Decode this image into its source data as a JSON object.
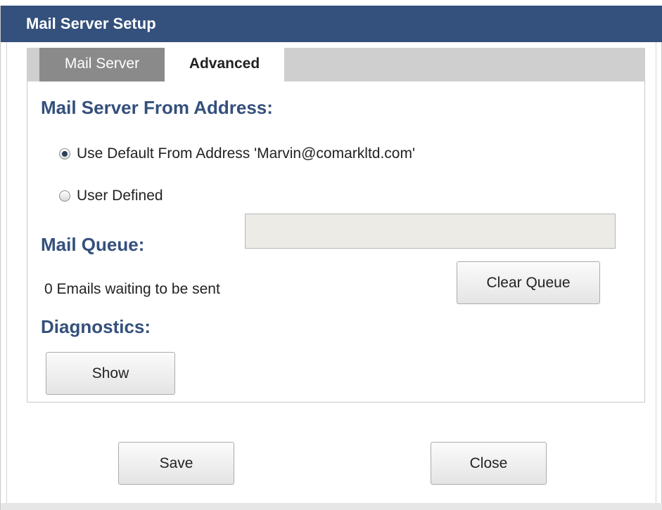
{
  "dialog": {
    "title": "Mail Server Setup"
  },
  "tabs": [
    {
      "label": "Mail Server",
      "active": false
    },
    {
      "label": "Advanced",
      "active": true
    }
  ],
  "from_address": {
    "heading": "Mail Server From Address:",
    "option_default": "Use Default From Address 'Marvin@comarkltd.com'",
    "option_user": "User Defined",
    "selected": "default",
    "user_value": "",
    "user_placeholder": ""
  },
  "mail_queue": {
    "heading": "Mail Queue:",
    "status": "0 Emails waiting to be sent",
    "clear_label": "Clear Queue"
  },
  "diagnostics": {
    "heading": "Diagnostics:",
    "show_label": "Show"
  },
  "footer": {
    "save_label": "Save",
    "close_label": "Close"
  },
  "colors": {
    "titlebar": "#34507c",
    "heading": "#34507c",
    "tab_inactive": "#8a8a8a",
    "tabstrip": "#cfcfcf"
  }
}
